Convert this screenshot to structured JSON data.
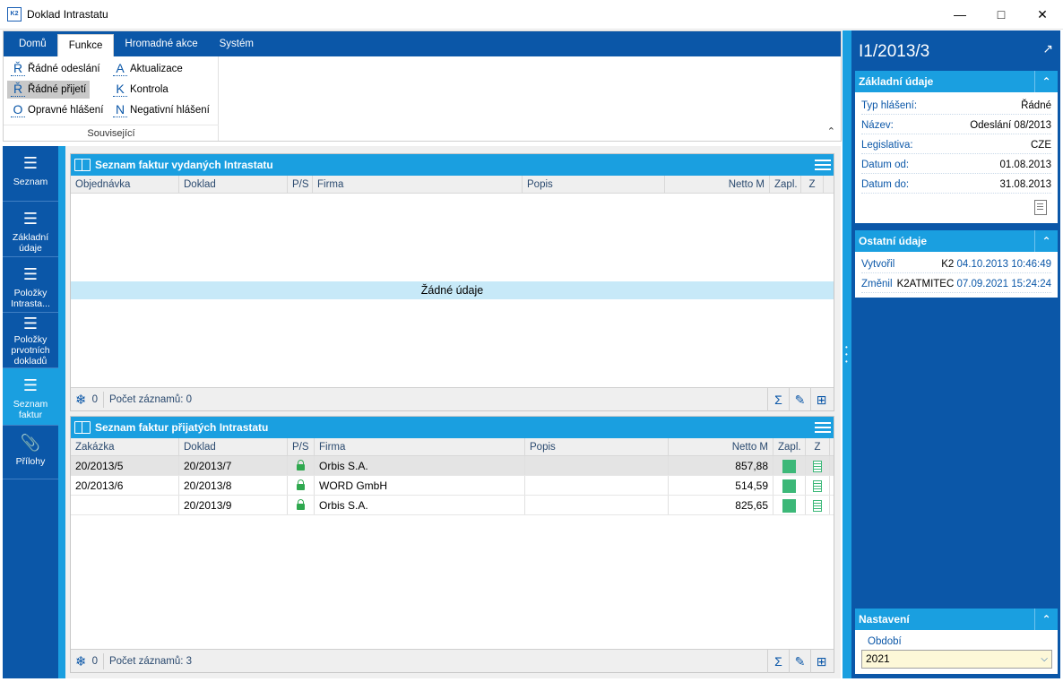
{
  "window": {
    "title": "Doklad Intrastatu",
    "app_badge": "K2"
  },
  "ribbon": {
    "tabs": [
      "Domů",
      "Funkce",
      "Hromadné akce",
      "Systém"
    ],
    "active_tab": "Funkce",
    "items": [
      {
        "key": "Ř",
        "label": "Řádné odeslání"
      },
      {
        "key": "A",
        "label": "Aktualizace"
      },
      {
        "key": "Ř",
        "label": "Řádné přijetí"
      },
      {
        "key": "K",
        "label": "Kontrola"
      },
      {
        "key": "O",
        "label": "Opravné hlášení"
      },
      {
        "key": "N",
        "label": "Negativní hlášení"
      }
    ],
    "group_label": "Související"
  },
  "nav": {
    "items": [
      {
        "label": "Seznam",
        "icon": "hamburger-icon"
      },
      {
        "label": "Základní údaje",
        "icon": "list-icon"
      },
      {
        "label": "Položky Intrasta...",
        "icon": "hamburger-icon"
      },
      {
        "label": "Položky prvotních dokladů",
        "icon": "hamburger-icon"
      },
      {
        "label": "Seznam faktur",
        "icon": "hamburger-icon"
      },
      {
        "label": "Přílohy",
        "icon": "paperclip-icon"
      }
    ],
    "active": "Seznam faktur"
  },
  "issued": {
    "title": "Seznam faktur vydaných Intrastatu",
    "columns": [
      "Objednávka",
      "Doklad",
      "P/S",
      "Firma",
      "Popis",
      "Netto M",
      "Zapl.",
      "Z"
    ],
    "empty_text": "Žádné údaje",
    "footer_count": "0",
    "footer_records": "Počet záznamů: 0"
  },
  "received": {
    "title": "Seznam faktur přijatých Intrastatu",
    "columns": [
      "Zakázka",
      "Doklad",
      "P/S",
      "Firma",
      "Popis",
      "Netto M",
      "Zapl.",
      "Z"
    ],
    "rows": [
      {
        "zakazka": "20/2013/5",
        "doklad": "20/2013/7",
        "firma": "Orbis S.A.",
        "popis": "",
        "netto": "857,88"
      },
      {
        "zakazka": "20/2013/6",
        "doklad": "20/2013/8",
        "firma": "WORD GmbH",
        "popis": "",
        "netto": "514,59"
      },
      {
        "zakazka": "",
        "doklad": "20/2013/9",
        "firma": "Orbis S.A.",
        "popis": "",
        "netto": "825,65"
      }
    ],
    "footer_count": "0",
    "footer_records": "Počet záznamů: 3"
  },
  "right": {
    "doc_id": "I1/2013/3",
    "basic": {
      "title": "Základní údaje",
      "fields": [
        {
          "k": "Typ hlášení:",
          "v": "Řádné"
        },
        {
          "k": "Název:",
          "v": "Odeslání 08/2013"
        },
        {
          "k": "Legislativa:",
          "v": "CZE"
        },
        {
          "k": "Datum od:",
          "v": "01.08.2013"
        },
        {
          "k": "Datum do:",
          "v": "31.08.2013"
        }
      ]
    },
    "other": {
      "title": "Ostatní údaje",
      "created_label": "Vytvořil",
      "created_user": "K2",
      "created_at": "04.10.2013 10:46:49",
      "changed_label": "Změnil",
      "changed_user": "K2ATMITEC",
      "changed_at": "07.09.2021 15:24:24"
    },
    "settings": {
      "title": "Nastavení",
      "period_label": "Období",
      "period_value": "2021"
    }
  },
  "colors": {
    "dark_blue": "#0b57a8",
    "light_blue": "#1a9fe0",
    "paid_green": "#3cb878"
  }
}
